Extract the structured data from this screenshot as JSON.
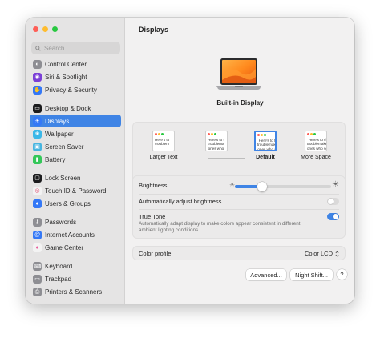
{
  "window": {
    "title": "Displays"
  },
  "sidebar": {
    "search_placeholder": "Search",
    "groups": [
      [
        {
          "label": "Control Center",
          "icon": "control-center-icon",
          "color": "#8e8e93",
          "glyph": "◐"
        },
        {
          "label": "Siri & Spotlight",
          "icon": "siri-icon",
          "color": "#7b3fd6",
          "glyph": "◉"
        },
        {
          "label": "Privacy & Security",
          "icon": "hand-icon",
          "color": "#3478f6",
          "glyph": "✋"
        }
      ],
      [
        {
          "label": "Desktop & Dock",
          "icon": "dock-icon",
          "color": "#1c1c1e",
          "glyph": "▭"
        },
        {
          "label": "Displays",
          "icon": "displays-icon",
          "color": "#3478f6",
          "glyph": "☀",
          "active": true
        },
        {
          "label": "Wallpaper",
          "icon": "wallpaper-icon",
          "color": "#3cb8e8",
          "glyph": "❀"
        },
        {
          "label": "Screen Saver",
          "icon": "screen-saver-icon",
          "color": "#47b5e0",
          "glyph": "▣"
        },
        {
          "label": "Battery",
          "icon": "battery-icon",
          "color": "#34c759",
          "glyph": "▮"
        }
      ],
      [
        {
          "label": "Lock Screen",
          "icon": "lock-screen-icon",
          "color": "#1c1c1e",
          "glyph": "▢"
        },
        {
          "label": "Touch ID & Password",
          "icon": "fingerprint-icon",
          "color": "#f3f3f3",
          "glyph": "◎",
          "glyphColor": "#e0456a"
        },
        {
          "label": "Users & Groups",
          "icon": "users-icon",
          "color": "#3478f6",
          "glyph": "●"
        }
      ],
      [
        {
          "label": "Passwords",
          "icon": "key-icon",
          "color": "#8e8e93",
          "glyph": "⚷"
        },
        {
          "label": "Internet Accounts",
          "icon": "at-icon",
          "color": "#3478f6",
          "glyph": "@"
        },
        {
          "label": "Game Center",
          "icon": "game-center-icon",
          "color": "#f3f3f3",
          "glyph": "●",
          "glyphColor": "#e85d9b"
        }
      ],
      [
        {
          "label": "Keyboard",
          "icon": "keyboard-icon",
          "color": "#8e8e93",
          "glyph": "⌨"
        },
        {
          "label": "Trackpad",
          "icon": "trackpad-icon",
          "color": "#8e8e93",
          "glyph": "▭"
        },
        {
          "label": "Printers & Scanners",
          "icon": "printer-icon",
          "color": "#8e8e93",
          "glyph": "⎙"
        }
      ]
    ]
  },
  "display": {
    "name": "Built-in Display",
    "resolutions": [
      {
        "label": "Larger Text",
        "sample": "Here's to\ntroublem",
        "selected": false
      },
      {
        "label": "",
        "sample": "Here's to t\ntroublema\nones who",
        "selected": false
      },
      {
        "label": "Default",
        "sample": "Here's to the\ntroublemakers\nones who see\nthings diff",
        "selected": true
      },
      {
        "label": "More Space",
        "sample": "Here's to the cr\ntroublemakers. T\nones who see thi\ndifferently",
        "selected": false
      }
    ]
  },
  "settings": {
    "brightness_label": "Brightness",
    "brightness_level": 0.28,
    "auto_brightness_label": "Automatically adjust brightness",
    "auto_brightness_on": false,
    "true_tone_label": "True Tone",
    "true_tone_desc": "Automatically adapt display to make colors appear consistent in different ambient lighting conditions.",
    "true_tone_on": true,
    "color_profile_label": "Color profile",
    "color_profile_value": "Color LCD"
  },
  "buttons": {
    "advanced": "Advanced...",
    "night_shift": "Night Shift...",
    "help": "?"
  },
  "colors": {
    "accent": "#3f84e5",
    "sidebar_bg": "#e5e4e4",
    "content_bg": "#f2f1f1"
  }
}
